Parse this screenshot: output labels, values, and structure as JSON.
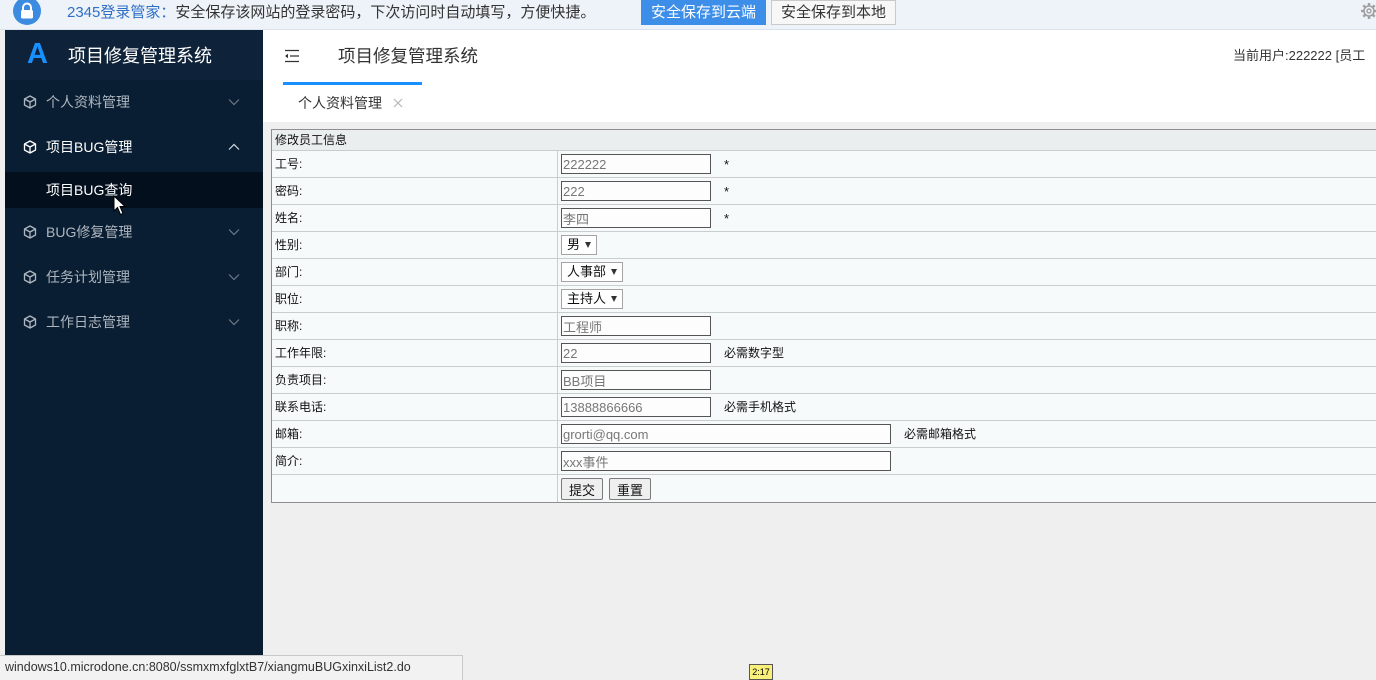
{
  "browser_bar": {
    "lock_icon": "lock-icon",
    "brand": "2345登录管家：",
    "message": "安全保存该网站的登录密码，下次访问时自动填写，方便快捷。",
    "save_cloud": "安全保存到云端",
    "save_local": "安全保存到本地",
    "settings_icon": "gear-icon"
  },
  "sidebar": {
    "logo": "A",
    "title": "项目修复管理系统",
    "menus": [
      {
        "label": "个人资料管理",
        "icon": "cube-icon",
        "expanded": false
      },
      {
        "label": "项目BUG管理",
        "icon": "cube-icon",
        "expanded": true,
        "children": [
          {
            "label": "项目BUG查询",
            "selected": true
          }
        ]
      },
      {
        "label": "BUG修复管理",
        "icon": "cube-icon",
        "expanded": false
      },
      {
        "label": "任务计划管理",
        "icon": "cube-icon",
        "expanded": false
      },
      {
        "label": "工作日志管理",
        "icon": "cube-icon",
        "expanded": false
      }
    ]
  },
  "header": {
    "menu_icon": "menu-fold-icon",
    "title": "项目修复管理系统",
    "current_user": "当前用户:222222 [员工"
  },
  "tabs": [
    {
      "label": "个人资料管理",
      "active": true,
      "close_icon": "close-icon"
    }
  ],
  "form": {
    "caption": "修改员工信息",
    "fields": [
      {
        "label": "工号:",
        "value": "222222",
        "hint": "*"
      },
      {
        "label": "密码:",
        "value": "222",
        "hint": "*"
      },
      {
        "label": "姓名:",
        "value": "李四",
        "hint": "*"
      },
      {
        "label": "性别:",
        "value": "男"
      },
      {
        "label": "部门:",
        "value": "人事部"
      },
      {
        "label": "职位:",
        "value": "主持人"
      },
      {
        "label": "职称:",
        "value": "工程师"
      },
      {
        "label": "工作年限:",
        "value": "22",
        "hint": "必需数字型"
      },
      {
        "label": "负责项目:",
        "value": "BB项目"
      },
      {
        "label": "联系电话:",
        "value": "13888866666",
        "hint": "必需手机格式"
      },
      {
        "label": "邮箱:",
        "value": "grorti@qq.com",
        "hint": "必需邮箱格式"
      },
      {
        "label": "简介:",
        "value": "xxx事件"
      }
    ],
    "submit": "提交",
    "reset": "重置"
  },
  "status_bar": {
    "url": "windows10.microdone.cn:8080/ssmxmxfglxtB7/xiangmuBUGxinxiList2.do"
  },
  "video_overlay": {
    "timestamp": "2:17"
  },
  "colors": {
    "sidebar_bg": "#0a1e33",
    "sidebar_header_bg": "#0e2339",
    "submenu_bg": "#030f1d",
    "accent": "#1890ff",
    "cloud_button_bg": "#3d8ee8",
    "brand_text": "#2f6fc6",
    "content_bg": "#efefef",
    "form_bg": "#f6fafa",
    "timestamp_bg": "#f8f07a"
  }
}
